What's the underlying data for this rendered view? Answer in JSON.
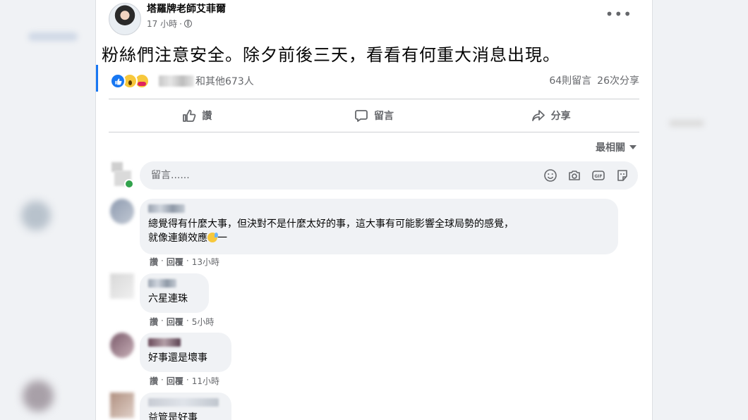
{
  "post": {
    "author": "塔羅牌老師艾菲爾",
    "time": "17 小時",
    "separator": "·",
    "more": "•••",
    "text": "粉絲們注意安全。除夕前後三天，看看有何重大消息出現。",
    "reactions_text": "和其他673人",
    "comments_count": "64則留言",
    "shares_count": "26次分享"
  },
  "actions": {
    "like": "讚",
    "comment": "留言",
    "share": "分享"
  },
  "sort_label": "最相關",
  "composer": {
    "placeholder": "留言......"
  },
  "comments": [
    {
      "text": "總覺得有什麼大事，但決對不是什麼太好的事，這大事有可能影響全球局勢的感覺，",
      "text2": "就像連鎖效應",
      "text2_tail": "一",
      "like": "讚",
      "dot": "·",
      "reply": "回覆",
      "time": "13小時"
    },
    {
      "text": "六星連珠",
      "like": "讚",
      "dot": "·",
      "reply": "回覆",
      "time": "5小時"
    },
    {
      "text": "好事還是壞事",
      "like": "讚",
      "dot": "·",
      "reply": "回覆",
      "time": "11小時"
    },
    {
      "text": "益管是好事"
    }
  ],
  "colors": {
    "accent": "#1877f2",
    "secondary_text": "#65676b",
    "bubble": "#f0f2f5"
  }
}
